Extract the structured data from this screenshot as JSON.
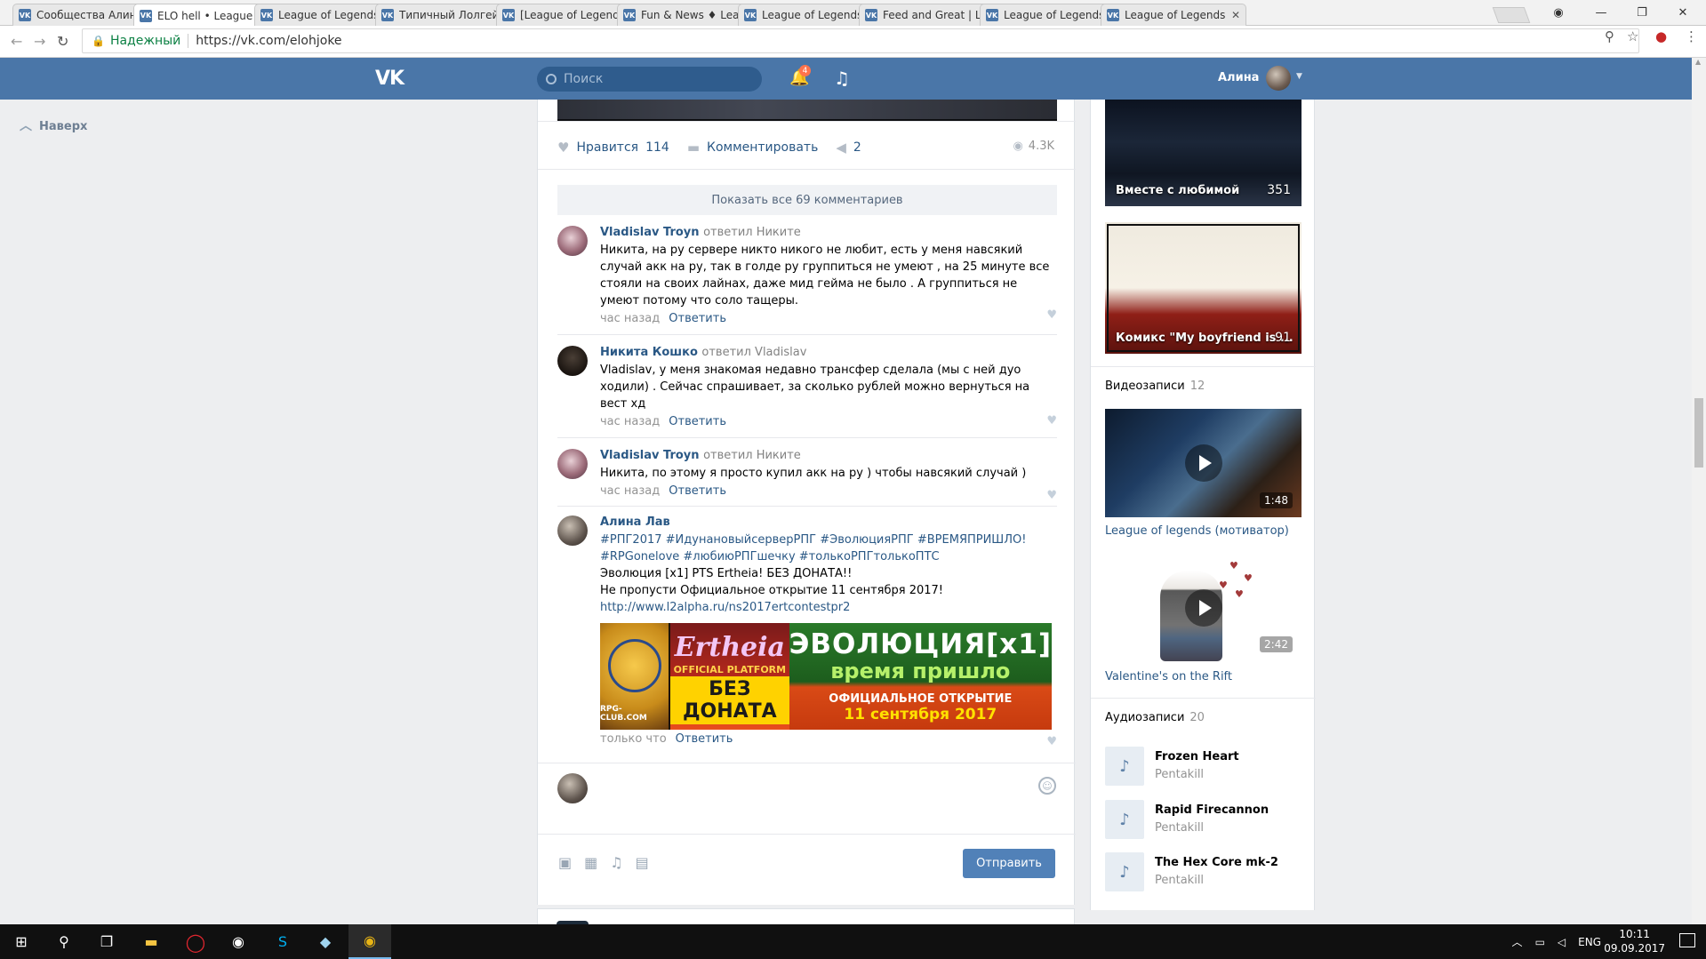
{
  "browser": {
    "tabs": [
      {
        "title": "Сообщества Алины",
        "active": false
      },
      {
        "title": "ELO hell • League of",
        "active": true
      },
      {
        "title": "League of Legends",
        "active": false
      },
      {
        "title": "Типичный Лолгейм",
        "active": false
      },
      {
        "title": "[League of Legends",
        "active": false
      },
      {
        "title": "Fun & News ♦ Leag",
        "active": false
      },
      {
        "title": "League of Legends",
        "active": false
      },
      {
        "title": "Feed and Great | Le",
        "active": false
      },
      {
        "title": "League of Legends",
        "active": false
      },
      {
        "title": "League of Legends",
        "active": false
      }
    ],
    "secure_label": "Надежный",
    "url": "https://vk.com/elohjoke"
  },
  "header": {
    "logo": "VK",
    "search_placeholder": "Поиск",
    "notif_count": "4",
    "user_name": "Алина"
  },
  "left": {
    "up_label": "Наверх"
  },
  "post": {
    "like_label": "Нравится",
    "like_count": "114",
    "comment_label": "Комментировать",
    "share_count": "2",
    "views": "4.3K",
    "show_all": "Показать все 69 комментариев",
    "comments": [
      {
        "author": "Vladislav Troyn",
        "reply_to": "ответил Никите",
        "text": "Никита, на ру сервере никто никого не любит, есть у меня навсякий случай акк на ру, так в голде ру группиться не умеют , на 25 минуте все стояли на своих лайнах, даже мид гейма не было . А группиться не умеют потому что соло тащеры.",
        "time": "час назад",
        "reply": "Ответить"
      },
      {
        "author": "Никита Кошко",
        "reply_to": "ответил Vladislav",
        "text": "Vladislav, у меня знакомая недавно трансфер сделала (мы с ней дуо ходили) . Сейчас спрашивает, за сколько рублей можно вернуться на вест хд",
        "time": "час назад",
        "reply": "Ответить"
      },
      {
        "author": "Vladislav Troyn",
        "reply_to": "ответил Никите",
        "text": "Никита, по этому я просто купил акк на ру ) чтобы навсякий случай )",
        "time": "час назад",
        "reply": "Ответить"
      },
      {
        "author": "Алина Лав",
        "reply_to": "",
        "hashtags1": "#РПГ2017 #ИдунановыйсерверРПГ #ЭволюцияРПГ #ВРЕМЯПРИШЛО!",
        "hashtags2": "#RPGonelove #любиюРПГшечку #толькоРПГтолькоПТС",
        "line1": "Эволюция [x1] PTS Ertheia! БЕЗ ДОНАТА!!",
        "line2": "Не пропусти Официальное открытие 11 сентября 2017!",
        "link": "http://www.l2alpha.ru/ns2017ertcontestpr2",
        "banner": {
          "site": "RPG-CLUB.COM",
          "logo": "Ertheia",
          "platform": "OFFICIAL PLATFORM",
          "no_donate": "БЕЗ ДОНАТА",
          "evo": "ЭВОЛЮЦИЯ[x1]",
          "time": "время пришло",
          "open": "ОФИЦИАЛЬНОЕ ОТКРЫТИЕ",
          "date": "11 сентября 2017"
        },
        "time": "только что",
        "reply": "Ответить"
      }
    ],
    "send_label": "Отправить"
  },
  "right": {
    "albums": [
      {
        "caption": "Вместе с любимой",
        "count": "351"
      },
      {
        "caption": "Комикс \"My boyfriend is ...",
        "count": "91"
      }
    ],
    "videos_title": "Видеозаписи",
    "videos_count": "12",
    "videos": [
      {
        "title": "League of legends (мотиватор)",
        "duration": "1:48"
      },
      {
        "title": "Valentine's on the Rift",
        "duration": "2:42"
      }
    ],
    "audio_title": "Аудиозаписи",
    "audio_count": "20",
    "audios": [
      {
        "name": "Frozen Heart",
        "artist": "Pentakill"
      },
      {
        "name": "Rapid Firecannon",
        "artist": "Pentakill"
      },
      {
        "name": "The Hex Core mk-2",
        "artist": "Pentakill"
      }
    ]
  },
  "taskbar": {
    "lang": "ENG",
    "time": "10:11",
    "date": "09.09.2017"
  }
}
